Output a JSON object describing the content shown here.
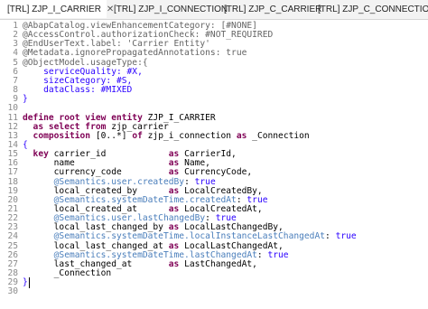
{
  "tabs": [
    {
      "label": "[TRL] ZJP_I_CARRIER",
      "close": "✕",
      "active": true
    },
    {
      "label": "[TRL] ZJP_I_CONNECTION",
      "active": false
    },
    {
      "label": "[TRL] ZJP_C_CARRIER",
      "active": false
    },
    {
      "label": "[TRL] ZJP_C_CONNECTION",
      "active": false
    }
  ],
  "editor": {
    "lines": [
      {
        "n": "1",
        "parts": [
          [
            "ann",
            "@AbapCatalog.viewEnhancementCategory: [#NONE]"
          ]
        ]
      },
      {
        "n": "2",
        "parts": [
          [
            "ann",
            "@AccessControl.authorizationCheck: #NOT_REQUIRED"
          ]
        ]
      },
      {
        "n": "3",
        "parts": [
          [
            "ann",
            "@EndUserText.label: 'Carrier Entity'"
          ]
        ]
      },
      {
        "n": "4",
        "parts": [
          [
            "ann",
            "@Metadata.ignorePropagatedAnnotations: true"
          ]
        ]
      },
      {
        "n": "5",
        "parts": [
          [
            "ann",
            "@ObjectModel.usageType:{"
          ]
        ]
      },
      {
        "n": "6",
        "parts": [
          [
            "str",
            "    serviceQuality: #X,"
          ]
        ]
      },
      {
        "n": "7",
        "parts": [
          [
            "str",
            "    sizeCategory: #S,"
          ]
        ]
      },
      {
        "n": "8",
        "parts": [
          [
            "str",
            "    dataClass: #MIXED"
          ]
        ]
      },
      {
        "n": "9",
        "parts": [
          [
            "str",
            "}"
          ]
        ]
      },
      {
        "n": "10",
        "parts": []
      },
      {
        "n": "11",
        "parts": [
          [
            "kw",
            "define root view entity "
          ],
          [
            "id",
            "ZJP_I_CARRIER"
          ]
        ]
      },
      {
        "n": "12",
        "parts": [
          [
            "kw",
            "  as select from "
          ],
          [
            "id",
            "zjp_carrier"
          ]
        ]
      },
      {
        "n": "13",
        "parts": [
          [
            "kw",
            "  composition "
          ],
          [
            "id",
            "[0..*] "
          ],
          [
            "kw",
            "of "
          ],
          [
            "id",
            "zjp_i_connection "
          ],
          [
            "kw",
            "as "
          ],
          [
            "id",
            "_Connection"
          ]
        ]
      },
      {
        "n": "14",
        "parts": [
          [
            "str",
            "{"
          ]
        ]
      },
      {
        "n": "15",
        "parts": [
          [
            "kw",
            "  key "
          ],
          [
            "id",
            "carrier_id            "
          ],
          [
            "kw",
            "as "
          ],
          [
            "id",
            "CarrierId,"
          ]
        ]
      },
      {
        "n": "16",
        "parts": [
          [
            "id",
            "      name                  "
          ],
          [
            "kw",
            "as "
          ],
          [
            "id",
            "Name,"
          ]
        ]
      },
      {
        "n": "17",
        "parts": [
          [
            "id",
            "      currency_code         "
          ],
          [
            "kw",
            "as "
          ],
          [
            "id",
            "CurrencyCode,"
          ]
        ]
      },
      {
        "n": "18",
        "parts": [
          [
            "sem",
            "      @Semantics.user.createdBy"
          ],
          [
            "id",
            ": "
          ],
          [
            "str",
            "true"
          ]
        ]
      },
      {
        "n": "19",
        "parts": [
          [
            "id",
            "      local_created_by      "
          ],
          [
            "kw",
            "as "
          ],
          [
            "id",
            "LocalCreatedBy,"
          ]
        ]
      },
      {
        "n": "20",
        "parts": [
          [
            "sem",
            "      @Semantics.systemDateTime.createdAt"
          ],
          [
            "id",
            ": "
          ],
          [
            "str",
            "true"
          ]
        ]
      },
      {
        "n": "21",
        "parts": [
          [
            "id",
            "      local_created_at      "
          ],
          [
            "kw",
            "as "
          ],
          [
            "id",
            "LocalCreatedAt,"
          ]
        ]
      },
      {
        "n": "22",
        "parts": [
          [
            "sem",
            "      @Semantics.user.lastChangedBy"
          ],
          [
            "id",
            ": "
          ],
          [
            "str",
            "true"
          ]
        ]
      },
      {
        "n": "23",
        "parts": [
          [
            "id",
            "      local_last_changed_by "
          ],
          [
            "kw",
            "as "
          ],
          [
            "id",
            "LocalLastChangedBy,"
          ]
        ]
      },
      {
        "n": "24",
        "parts": [
          [
            "sem",
            "      @Semantics.systemDateTime.localInstanceLastChangedAt"
          ],
          [
            "id",
            ": "
          ],
          [
            "str",
            "true"
          ]
        ]
      },
      {
        "n": "25",
        "parts": [
          [
            "id",
            "      local_last_changed_at "
          ],
          [
            "kw",
            "as "
          ],
          [
            "id",
            "LocalLastChangedAt,"
          ]
        ]
      },
      {
        "n": "26",
        "parts": [
          [
            "sem",
            "      @Semantics.systemDateTime.lastChangedAt"
          ],
          [
            "id",
            ": "
          ],
          [
            "str",
            "true"
          ]
        ]
      },
      {
        "n": "27",
        "parts": [
          [
            "id",
            "      last_changed_at       "
          ],
          [
            "kw",
            "as "
          ],
          [
            "id",
            "LastChangedAt,"
          ]
        ]
      },
      {
        "n": "28",
        "parts": [
          [
            "id",
            "      _Connection"
          ]
        ]
      },
      {
        "n": "29",
        "parts": [
          [
            "str",
            "}"
          ]
        ]
      },
      {
        "n": "30",
        "parts": []
      }
    ]
  },
  "colors": {
    "ann": "#646464",
    "keyword": "#7f0055",
    "string": "#2a00ff",
    "semantics": "#4a7ebb",
    "tab_active": "#ffffff",
    "tab_bar": "#f3f3f3"
  }
}
